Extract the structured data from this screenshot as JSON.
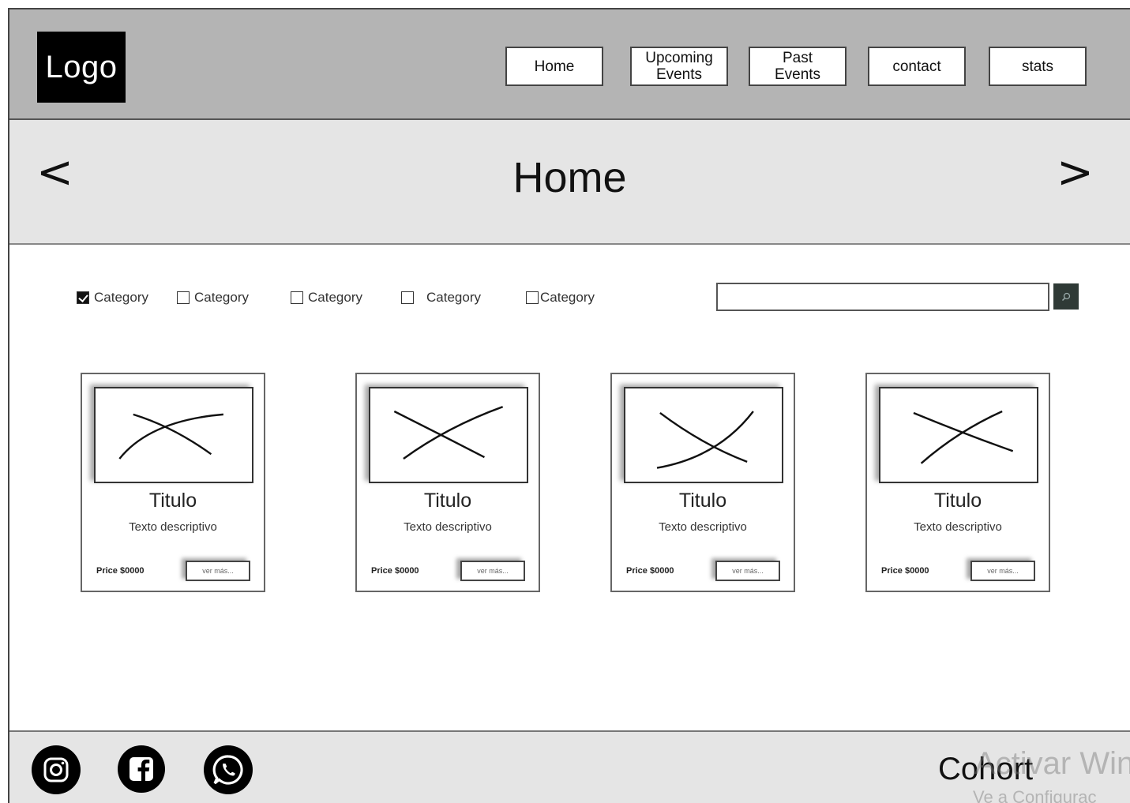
{
  "header": {
    "logo_text": "Logo",
    "nav": [
      {
        "label": "Home"
      },
      {
        "label": "Upcoming\nEvents"
      },
      {
        "label": "Past\nEvents"
      },
      {
        "label": "contact"
      },
      {
        "label": "stats"
      }
    ]
  },
  "hero": {
    "title": "Home",
    "prev_label": "<",
    "next_label": ">"
  },
  "filters": {
    "categories": [
      {
        "label": "Category",
        "checked": true
      },
      {
        "label": "Category",
        "checked": false
      },
      {
        "label": "Category",
        "checked": false
      },
      {
        "label": "Category",
        "checked": false
      },
      {
        "label": "Category",
        "checked": false
      }
    ],
    "search": {
      "value": "",
      "placeholder": "",
      "icon": "search-icon"
    }
  },
  "cards": [
    {
      "title": "Titulo",
      "description": "Texto descriptivo",
      "price": "Price $0000",
      "button": "ver más..."
    },
    {
      "title": "Titulo",
      "description": "Texto descriptivo",
      "price": "Price $0000",
      "button": "ver más..."
    },
    {
      "title": "Titulo",
      "description": "Texto descriptivo",
      "price": "Price $0000",
      "button": "ver más..."
    },
    {
      "title": "Titulo",
      "description": "Texto descriptivo",
      "price": "Price $0000",
      "button": "ver más..."
    }
  ],
  "footer": {
    "social": [
      "instagram-icon",
      "facebook-icon",
      "whatsapp-icon"
    ],
    "brand": "Cohort",
    "watermark_line1": "Activar Win",
    "watermark_line2": "Ve a Configurac"
  }
}
